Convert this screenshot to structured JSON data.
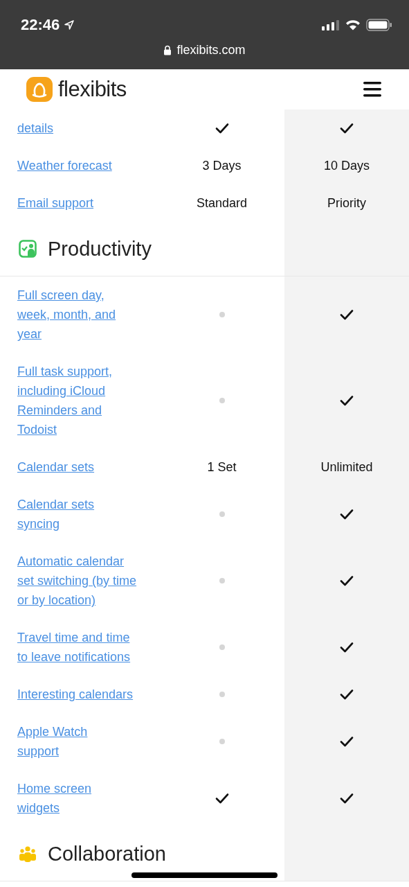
{
  "status_bar": {
    "time": "22:46"
  },
  "address_bar": {
    "url": "flexibits.com"
  },
  "header": {
    "logo_text": "flexibits"
  },
  "rows": [
    {
      "feature": "details",
      "cells": [
        {
          "kind": "check"
        },
        {
          "kind": "check"
        }
      ]
    },
    {
      "feature": "Weather forecast",
      "cells": [
        {
          "kind": "text",
          "text": "3 Days"
        },
        {
          "kind": "text",
          "text": "10 Days"
        }
      ]
    },
    {
      "feature": "Email support",
      "cells": [
        {
          "kind": "text",
          "text": "Standard"
        },
        {
          "kind": "text",
          "text": "Priority"
        }
      ]
    }
  ],
  "sections": [
    {
      "title": "Productivity",
      "rows": [
        {
          "feature": "Full screen day,\nweek, month, and\nyear",
          "cells": [
            {
              "kind": "dot"
            },
            {
              "kind": "check"
            }
          ]
        },
        {
          "feature": "Full task support,\nincluding iCloud\nReminders and\nTodoist",
          "cells": [
            {
              "kind": "dot"
            },
            {
              "kind": "check"
            }
          ]
        },
        {
          "feature": "Calendar sets",
          "cells": [
            {
              "kind": "text",
              "text": "1 Set"
            },
            {
              "kind": "text",
              "text": "Unlimited"
            }
          ]
        },
        {
          "feature": "Calendar sets\nsyncing",
          "cells": [
            {
              "kind": "dot"
            },
            {
              "kind": "check"
            }
          ]
        },
        {
          "feature": "Automatic calendar\nset switching (by time\nor by location)",
          "cells": [
            {
              "kind": "dot"
            },
            {
              "kind": "check"
            }
          ]
        },
        {
          "feature": "Travel time and time\nto leave notifications",
          "cells": [
            {
              "kind": "dot"
            },
            {
              "kind": "check"
            }
          ]
        },
        {
          "feature": "Interesting calendars",
          "cells": [
            {
              "kind": "dot"
            },
            {
              "kind": "check"
            }
          ]
        },
        {
          "feature": "Apple Watch\nsupport",
          "cells": [
            {
              "kind": "dot"
            },
            {
              "kind": "check"
            }
          ]
        },
        {
          "feature": "Home screen\nwidgets",
          "cells": [
            {
              "kind": "check"
            },
            {
              "kind": "check"
            }
          ]
        }
      ]
    },
    {
      "title": "Collaboration"
    }
  ]
}
